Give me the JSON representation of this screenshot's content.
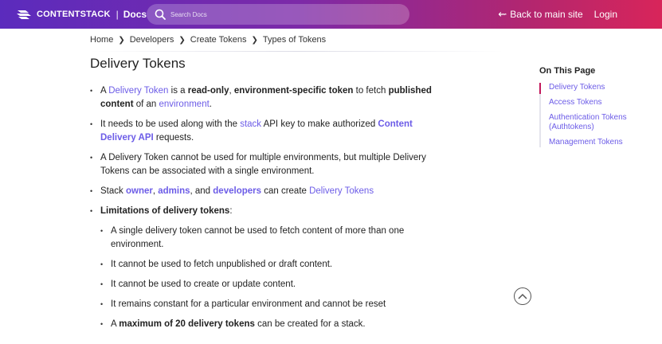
{
  "header": {
    "brand_name": "CONTENTSTACK",
    "brand_separator": "|",
    "brand_docs": "Docs",
    "search_placeholder": "Search Docs",
    "back_arrow": "⇜",
    "back_label": "Back to main site",
    "login_label": "Login"
  },
  "breadcrumb": {
    "items": [
      "Home",
      "Developers",
      "Create Tokens",
      "Types of Tokens"
    ],
    "separator": "❯"
  },
  "page_title": "Delivery Tokens",
  "content": {
    "b1": {
      "t1": "A ",
      "l1": "Delivery Token",
      "t2": " is a ",
      "b1": "read-only",
      "t3": ", ",
      "b2": "environment-specific token",
      "t4": " to fetch ",
      "b3": "published content",
      "t5": " of an ",
      "l2": "environment",
      "t6": "."
    },
    "b2": {
      "t1": "It needs to be used along with the ",
      "l1": "stack",
      "t2": " API key to make authorized ",
      "l2": "Content Delivery API",
      "t3": " requests."
    },
    "b3": {
      "t1": "A Delivery Token cannot be used for multiple environments, but multiple Delivery Tokens can be associated with a single environment."
    },
    "b4": {
      "t1": "Stack ",
      "l1": "owner",
      "t2": ", ",
      "l2": "admins",
      "t3": ", and ",
      "l3": "developers",
      "t4": " can create ",
      "l4": "Delivery Tokens"
    },
    "b5": {
      "b1": "Limitations of delivery tokens",
      "t1": ":"
    },
    "sub": {
      "s1": "A single delivery token cannot be used to fetch content of more than one environment.",
      "s2": "It cannot be used to fetch unpublished or draft content.",
      "s3": "It cannot be used to create or update content.",
      "s4": "It remains constant for a particular environment and cannot be reset",
      "s5": {
        "t1": "A ",
        "b1": "maximum of 20 delivery tokens",
        "t2": " can be created for a stack."
      }
    }
  },
  "toc": {
    "title": "On This Page",
    "items": [
      "Delivery Tokens",
      "Access Tokens",
      "Authentication Tokens (Authtokens)",
      "Management Tokens"
    ]
  },
  "colors": {
    "link": "#6c5ce7",
    "toc_active": "#c2185b",
    "header_gradient_start": "#5b2bbd",
    "header_gradient_end": "#d8255a"
  },
  "icons": {
    "brand": "contentstack-logo-icon",
    "search": "search-icon",
    "scroll_top": "chevron-up-icon"
  }
}
